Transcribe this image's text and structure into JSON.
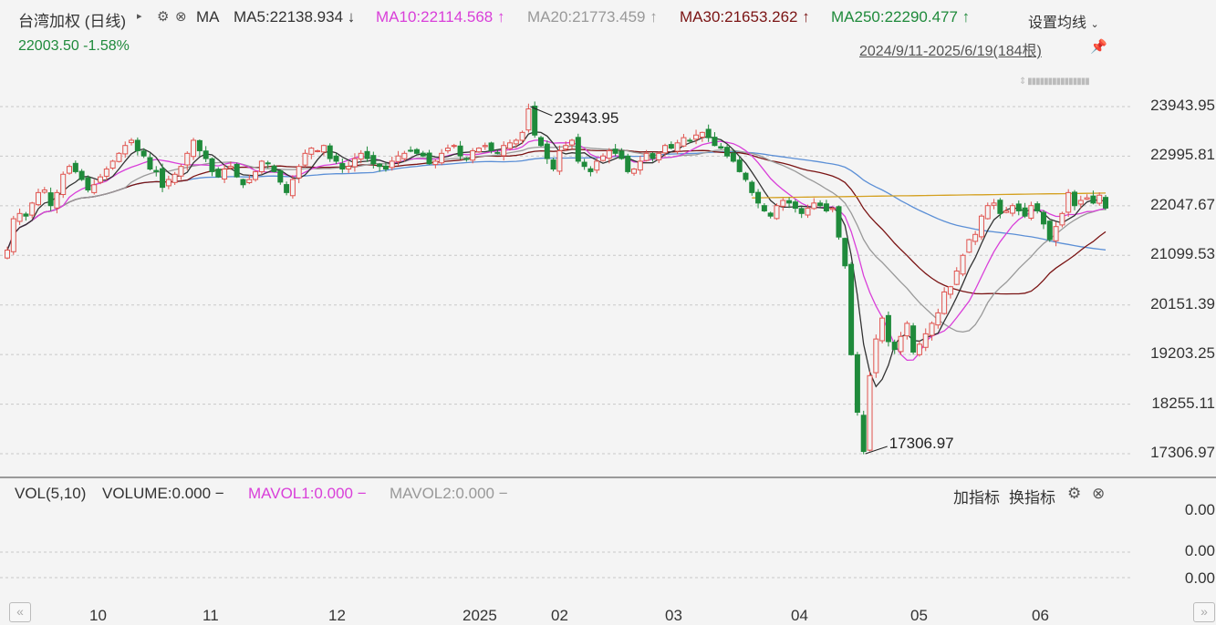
{
  "header": {
    "title": "台湾加权 (日线)",
    "ma_label": "MA",
    "ma5": "MA5:22138.934 ↓",
    "ma10": "MA10:22114.568 ↑",
    "ma20": "MA20:21773.459 ↑",
    "ma30": "MA30:21653.262 ↑",
    "ma250": "MA250:22290.477 ↑",
    "settings_label": "设置均线",
    "price": "22003.50 -1.58%",
    "date_range": "2024/9/11-2025/6/19(184根)"
  },
  "colors": {
    "up": "#e0534e",
    "down": "#1f8a3b",
    "ma5": "#333333",
    "ma10": "#d93fd9",
    "ma20": "#999999",
    "ma30": "#7a1414",
    "ma250": "#d4a020",
    "ma60": "#5b8fd6",
    "price_text": "#1f8a3b"
  },
  "volume": {
    "label": "VOL(5,10)",
    "volume": "VOLUME:0.000 −",
    "mavol1": "MAVOL1:0.000 −",
    "mavol2": "MAVOL2:0.000 −",
    "add_indicator": "加指标",
    "switch_indicator": "换指标",
    "ticks": [
      "0.00",
      "0.00",
      "0.00"
    ]
  },
  "chart_data": {
    "type": "candlestick",
    "title": "台湾加权 (日线)",
    "ylim": [
      17306.97,
      23943.95
    ],
    "y_ticks": [
      "23943.95",
      "22995.81",
      "22047.67",
      "21099.53",
      "20151.39",
      "19203.25",
      "18255.11",
      "17306.97"
    ],
    "x_ticks": [
      "10",
      "11",
      "12",
      "2025",
      "02",
      "03",
      "04",
      "05",
      "06"
    ],
    "annotations": [
      {
        "label": "23943.95",
        "type": "max"
      },
      {
        "label": "17306.97",
        "type": "min"
      }
    ],
    "close": [
      21200,
      21800,
      21900,
      21850,
      22100,
      22300,
      22350,
      22050,
      22300,
      22650,
      22800,
      22700,
      22550,
      22350,
      22450,
      22600,
      22750,
      22900,
      23050,
      23200,
      23300,
      23100,
      23000,
      22750,
      22700,
      22400,
      22550,
      22650,
      22800,
      23050,
      23300,
      23100,
      22950,
      22700,
      22600,
      22750,
      22800,
      22600,
      22450,
      22550,
      22700,
      22900,
      22850,
      22700,
      22500,
      22300,
      22550,
      22800,
      23050,
      23150,
      23100,
      23200,
      22950,
      22900,
      22750,
      22800,
      22950,
      23050,
      22950,
      22850,
      22800,
      22750,
      22900,
      23000,
      23050,
      23100,
      23050,
      23000,
      22850,
      22900,
      23050,
      23150,
      23200,
      23000,
      22950,
      23100,
      23150,
      23200,
      23100,
      23050,
      23200,
      23250,
      23300,
      23450,
      23900,
      23400,
      23200,
      22950,
      22750,
      23100,
      23200,
      23300,
      22900,
      22800,
      22700,
      22900,
      23000,
      23100,
      23050,
      22950,
      22700,
      22750,
      22900,
      23050,
      22950,
      23050,
      23200,
      23150,
      23250,
      23350,
      23300,
      23400,
      23450,
      23350,
      23200,
      23150,
      23000,
      22900,
      22700,
      22550,
      22300,
      22100,
      21950,
      21850,
      22050,
      22150,
      22100,
      22000,
      21900,
      22000,
      22100,
      22050,
      21950,
      22000,
      21450,
      20900,
      19200,
      18100,
      17350,
      18800,
      19500,
      19900,
      19450,
      19300,
      19550,
      19800,
      19250,
      19400,
      19600,
      19800,
      20000,
      20400,
      20500,
      20800,
      21100,
      21400,
      21500,
      21850,
      22050,
      22100,
      21900,
      21950,
      22050,
      21950,
      21850,
      22050,
      21950,
      21700,
      21400,
      21650,
      21900,
      22300,
      22050,
      22150,
      22200,
      22100,
      22250,
      22003.5
    ],
    "ma_series": [
      {
        "name": "MA5",
        "value": "22138.934"
      },
      {
        "name": "MA10",
        "value": "22114.568"
      },
      {
        "name": "MA20",
        "value": "21773.459"
      },
      {
        "name": "MA30",
        "value": "21653.262"
      },
      {
        "name": "MA250",
        "value": "22290.477"
      }
    ]
  }
}
